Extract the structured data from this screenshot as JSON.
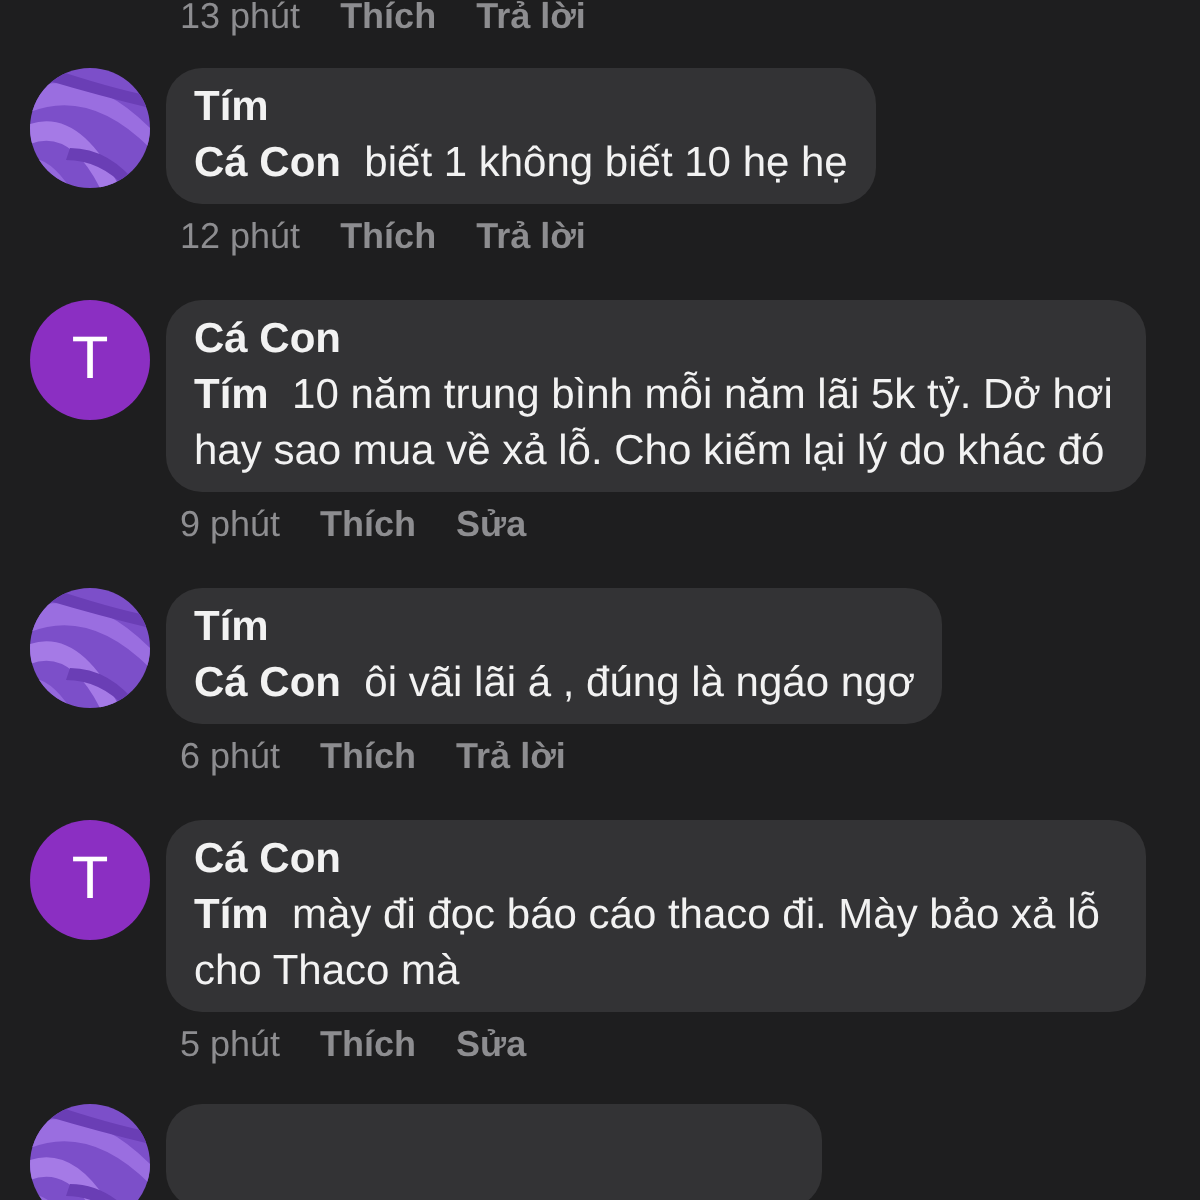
{
  "top_meta": {
    "time": "13 phút",
    "actions": [
      "Thích",
      "Trả lời"
    ]
  },
  "comments": [
    {
      "author": "Tím",
      "text": "**Cá Con**  biết 1 không biết 10 hẹ hẹ",
      "time": "12 phút",
      "actions": [
        "Thích",
        "Trả lời"
      ]
    },
    {
      "avatar": {
        "kind": "initial",
        "initial": "T"
      },
      "author": "Cá Con",
      "text": "**Tím**  10 năm trung bình mỗi năm lãi 5k tỷ. Dở hơi hay sao mua về xả lỗ. Cho kiếm lại lý do khác đó",
      "time": "9 phút",
      "actions": [
        "Thích",
        "Sửa"
      ]
    },
    {
      "author": "Tím",
      "text": "**Cá Con**  ôi vãi lãi á , đúng là ngáo ngơ",
      "time": "6 phút",
      "actions": [
        "Thích",
        "Trả lời"
      ]
    },
    {
      "avatar": {
        "kind": "initial",
        "initial": "T"
      },
      "author": "Cá Con",
      "text": "**Tím**  mày đi đọc báo cáo thaco đi. Mày bảo xả lỗ cho Thaco mà",
      "time": "5 phút",
      "actions": [
        "Thích",
        "Sửa"
      ]
    }
  ]
}
